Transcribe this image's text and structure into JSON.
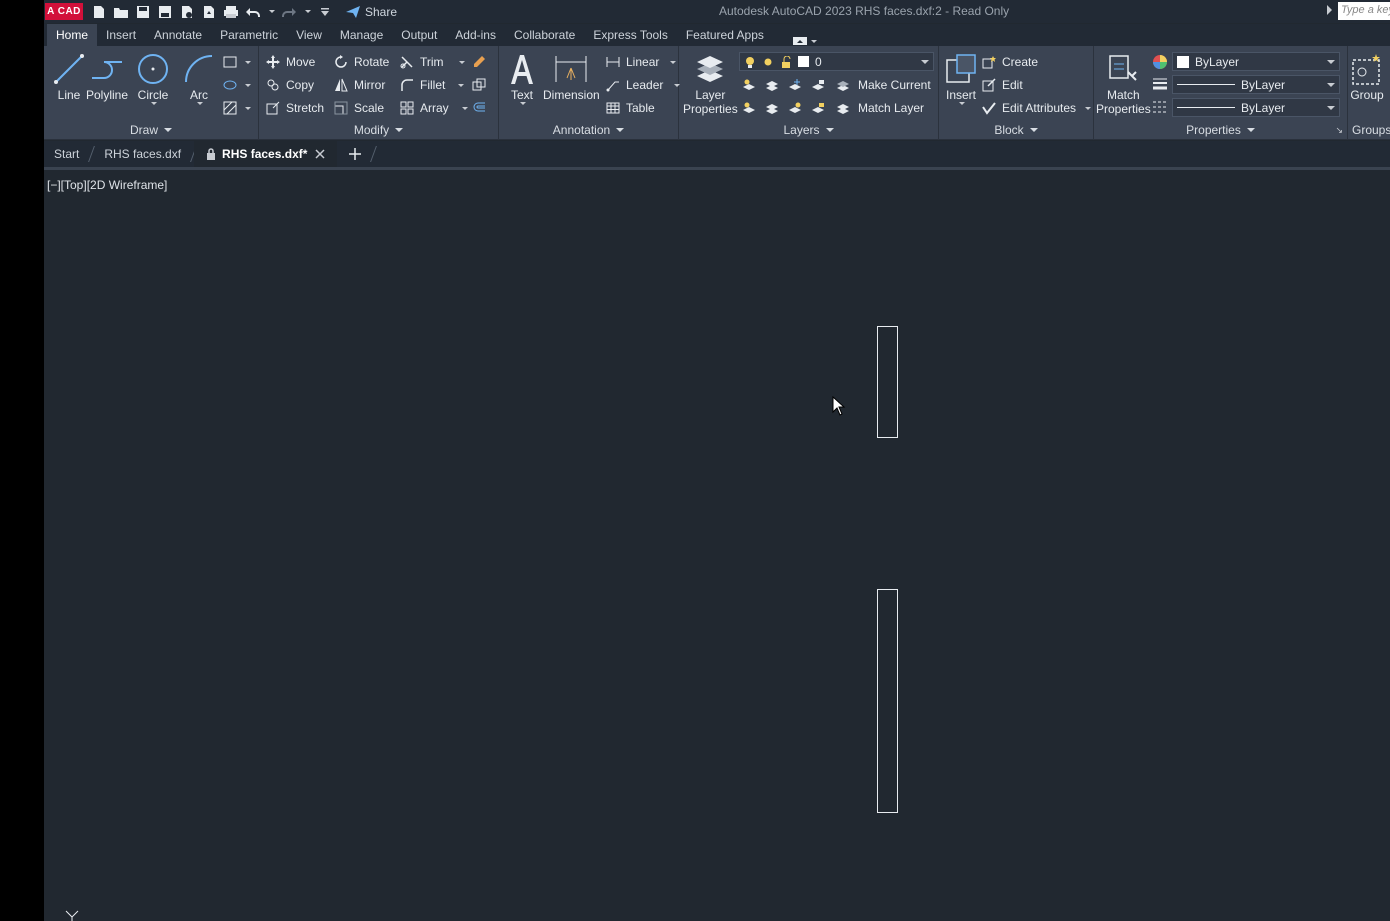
{
  "app": {
    "logo": "A CAD",
    "title": "Autodesk AutoCAD 2023   RHS faces.dxf:2 - Read Only",
    "search_placeholder": "Type a keyword",
    "share_label": "Share"
  },
  "tabs": [
    "Home",
    "Insert",
    "Annotate",
    "Parametric",
    "View",
    "Manage",
    "Output",
    "Add-ins",
    "Collaborate",
    "Express Tools",
    "Featured Apps"
  ],
  "ribbon": {
    "draw": {
      "label": "Draw",
      "line": "Line",
      "polyline": "Polyline",
      "circle": "Circle",
      "arc": "Arc"
    },
    "modify": {
      "label": "Modify",
      "move": "Move",
      "rotate": "Rotate",
      "trim": "Trim",
      "copy": "Copy",
      "mirror": "Mirror",
      "fillet": "Fillet",
      "stretch": "Stretch",
      "scale": "Scale",
      "array": "Array"
    },
    "annotation": {
      "label": "Annotation",
      "text": "Text",
      "dimension": "Dimension",
      "linear": "Linear",
      "leader": "Leader",
      "table": "Table"
    },
    "layers": {
      "label": "Layers",
      "layer_properties_1": "Layer",
      "layer_properties_2": "Properties",
      "current_layer": "0",
      "make_current": "Make Current",
      "match_layer": "Match Layer"
    },
    "block": {
      "label": "Block",
      "insert": "Insert",
      "create": "Create",
      "edit": "Edit",
      "edit_attributes": "Edit Attributes"
    },
    "properties": {
      "label": "Properties",
      "match_1": "Match",
      "match_2": "Properties",
      "color": "ByLayer",
      "lineweight": "ByLayer",
      "linetype": "ByLayer"
    },
    "groups": {
      "label": "Groups",
      "group": "Group"
    }
  },
  "doc_tabs": {
    "start": "Start",
    "file1": "RHS faces.dxf",
    "file2": "RHS faces.dxf*"
  },
  "viewport": {
    "label": "[−][Top][2D Wireframe]"
  }
}
